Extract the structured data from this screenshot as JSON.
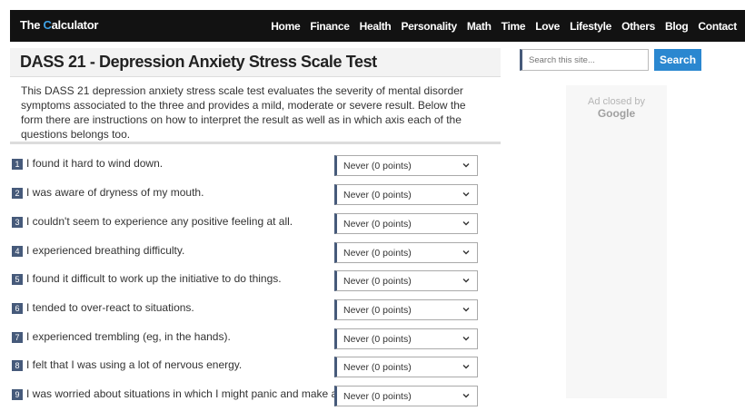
{
  "header": {
    "logo_part1": "The ",
    "logo_accent": "C",
    "logo_part2": "alculator",
    "nav": [
      "Home",
      "Finance",
      "Health",
      "Personality",
      "Math",
      "Time",
      "Love",
      "Lifestyle",
      "Others",
      "Blog",
      "Contact"
    ]
  },
  "page": {
    "title": "DASS 21 - Depression Anxiety Stress Scale Test",
    "intro": "This DASS 21 depression anxiety stress scale test evaluates the severity of mental disorder symptoms associated to the three and provides a mild, moderate or severe result. Below the form there are instructions on how to interpret the result as well as in which axis each of the questions belongs too."
  },
  "questions": [
    {
      "num": "1",
      "text": "I found it hard to wind down.",
      "answer": "Never (0 points)"
    },
    {
      "num": "2",
      "text": "I was aware of dryness of my mouth.",
      "answer": "Never (0 points)"
    },
    {
      "num": "3",
      "text": "I couldn't seem to experience any positive feeling at all.",
      "answer": "Never (0 points)"
    },
    {
      "num": "4",
      "text": "I experienced breathing difficulty.",
      "answer": "Never (0 points)"
    },
    {
      "num": "5",
      "text": "I found it difficult to work up the initiative to do things.",
      "answer": "Never (0 points)"
    },
    {
      "num": "6",
      "text": "I tended to over-react to situations.",
      "answer": "Never (0 points)"
    },
    {
      "num": "7",
      "text": "I experienced trembling (eg, in the hands).",
      "answer": "Never (0 points)"
    },
    {
      "num": "8",
      "text": "I felt that I was using a lot of nervous energy.",
      "answer": "Never (0 points)"
    },
    {
      "num": "9",
      "text": "I was worried about situations in which I might panic and make a",
      "answer": "Never (0 points)"
    }
  ],
  "sidebar": {
    "search_placeholder": "Search this site...",
    "search_button": "Search",
    "ad_line1": "Ad closed by",
    "ad_line2": "Google"
  },
  "colors": {
    "topbar": "#121212",
    "accent": "#3ea2e6",
    "search_button": "#2a87d0",
    "number_badge": "#465a7a"
  }
}
